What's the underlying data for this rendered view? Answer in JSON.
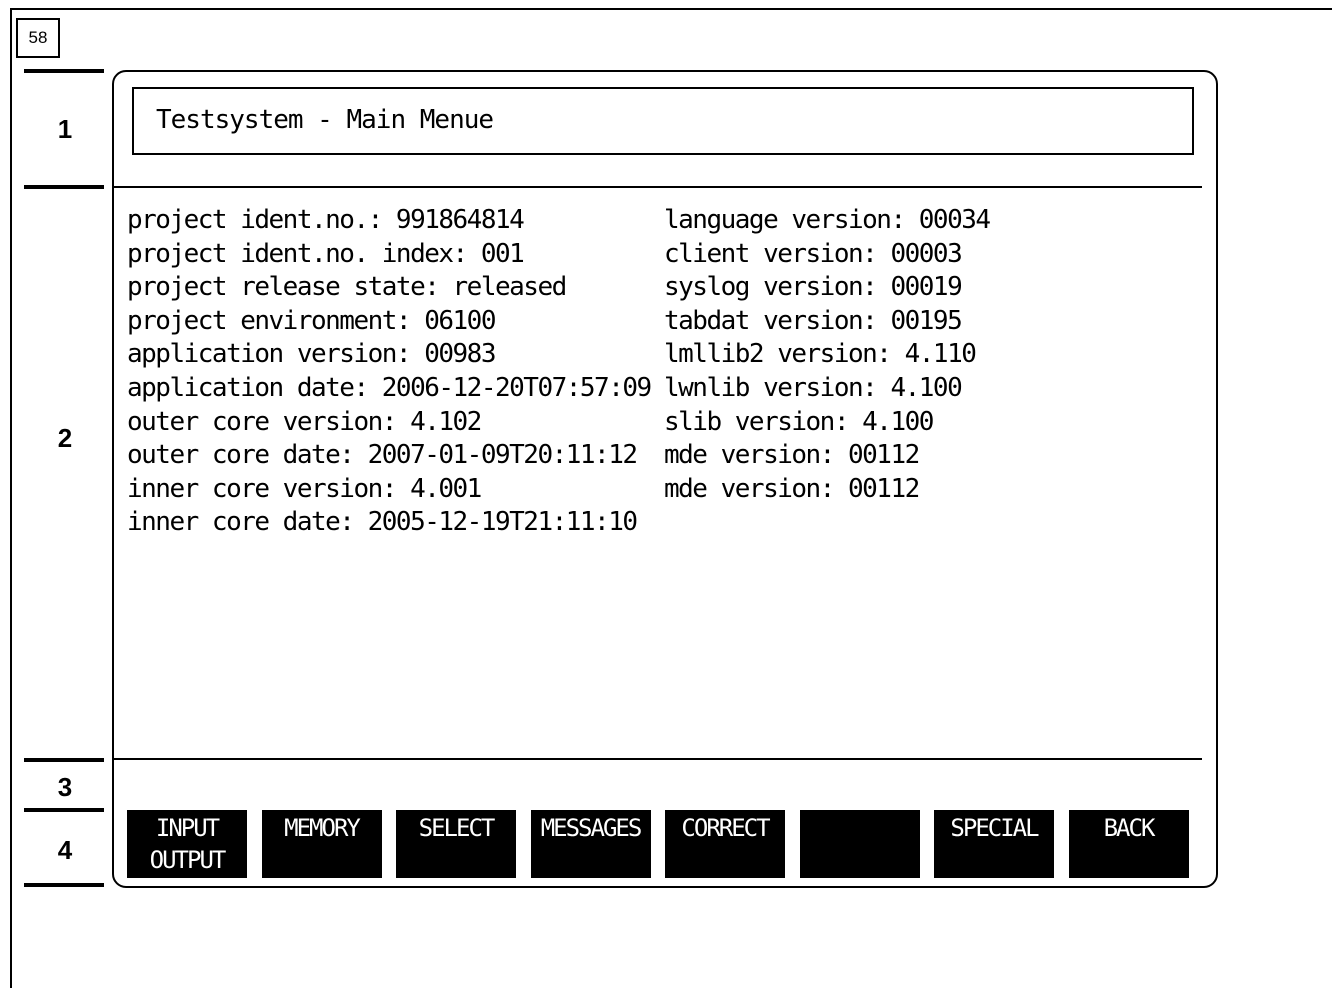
{
  "page_number": "58",
  "zones": [
    "1",
    "2",
    "3",
    "4"
  ],
  "title": "Testsystem - Main Menue",
  "info_left": [
    "project ident.no.: 991864814",
    "project ident.no. index: 001",
    "project release state: released",
    "project environment: 06100",
    "application version: 00983",
    "application date: 2006-12-20T07:57:09",
    "outer core version: 4.102",
    "outer core date: 2007-01-09T20:11:12",
    "inner core version: 4.001",
    "inner core date: 2005-12-19T21:11:10"
  ],
  "info_right": [
    "language version: 00034",
    "client version: 00003",
    "syslog version: 00019",
    "tabdat version: 00195",
    "lmllib2 version: 4.110",
    "lwnlib version: 4.100",
    "slib version: 4.100",
    "mde version: 00112",
    "mde version: 00112"
  ],
  "softkeys": [
    "INPUT\nOUTPUT",
    "MEMORY",
    "SELECT",
    "MESSAGES",
    "CORRECT",
    "",
    "SPECIAL",
    "BACK"
  ]
}
